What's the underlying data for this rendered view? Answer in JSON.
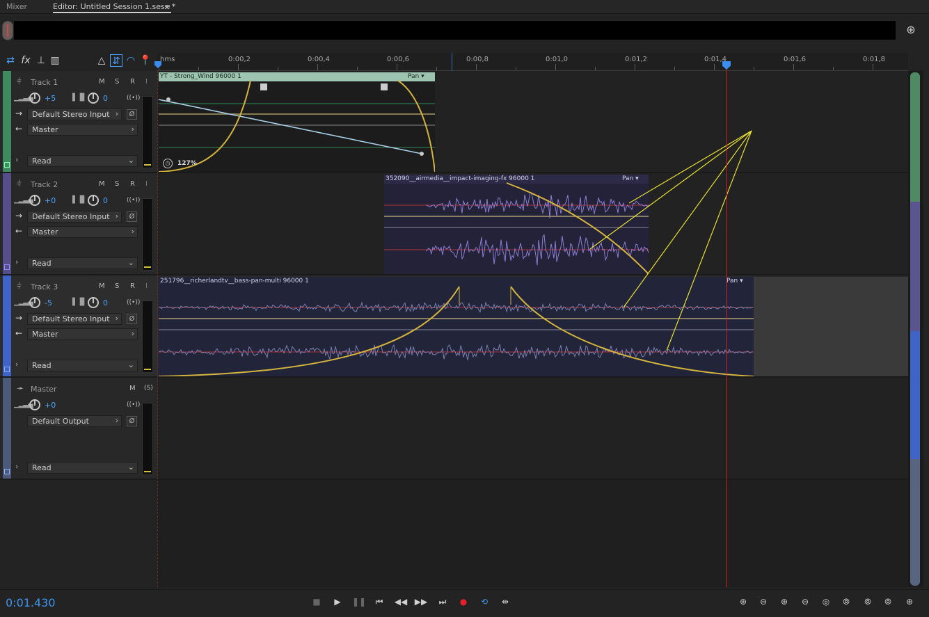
{
  "tabs": {
    "mixer": "Mixer",
    "editor": "Editor: Untitled Session 1.sesx *",
    "menu_glyph": "≡"
  },
  "ruler": {
    "labels": [
      "hms",
      "0:00,2",
      "0:00,4",
      "0:00,6",
      "0:00,8",
      "0:01,0",
      "0:01,2",
      "0:01,4",
      "0:01,6",
      "0:01,8"
    ]
  },
  "tracks": [
    {
      "name": "Track 1",
      "m": "M",
      "s": "S",
      "r": "R",
      "volume": "+5",
      "pan": "0",
      "input": "Default Stereo Input",
      "output": "Master",
      "automation": "Read",
      "color": "#3f8a5e"
    },
    {
      "name": "Track 2",
      "m": "M",
      "s": "S",
      "r": "R",
      "volume": "+0",
      "pan": "0",
      "input": "Default Stereo Input",
      "output": "Master",
      "automation": "Read",
      "color": "#564e8a"
    },
    {
      "name": "Track 3",
      "m": "M",
      "s": "S",
      "r": "R",
      "volume": "-5",
      "pan": "0",
      "input": "Default Stereo Input",
      "output": "Master",
      "automation": "Read",
      "color": "#3f63c7"
    }
  ],
  "master": {
    "name": "Master",
    "m": "M",
    "s": "(S)",
    "volume": "+0",
    "output": "Default Output",
    "automation": "Read",
    "color": "#4a5a78"
  },
  "clips": {
    "clip1": {
      "title": "YT - Strong_Wind 96000 1",
      "pan": "Pan",
      "stretch": "127%"
    },
    "clip2": {
      "title": "352090__airmedia__impact-imaging-fx 96000 1",
      "pan": "Pan"
    },
    "clip3": {
      "title": "251796__richerlandtv__bass-pan-multi 96000 1",
      "pan": "Pan"
    }
  },
  "transport": {
    "timecode": "0:01.430"
  },
  "colors": {
    "accent": "#3d95ee",
    "playhead": "#c8262b",
    "envelope": "#d4b43c"
  }
}
